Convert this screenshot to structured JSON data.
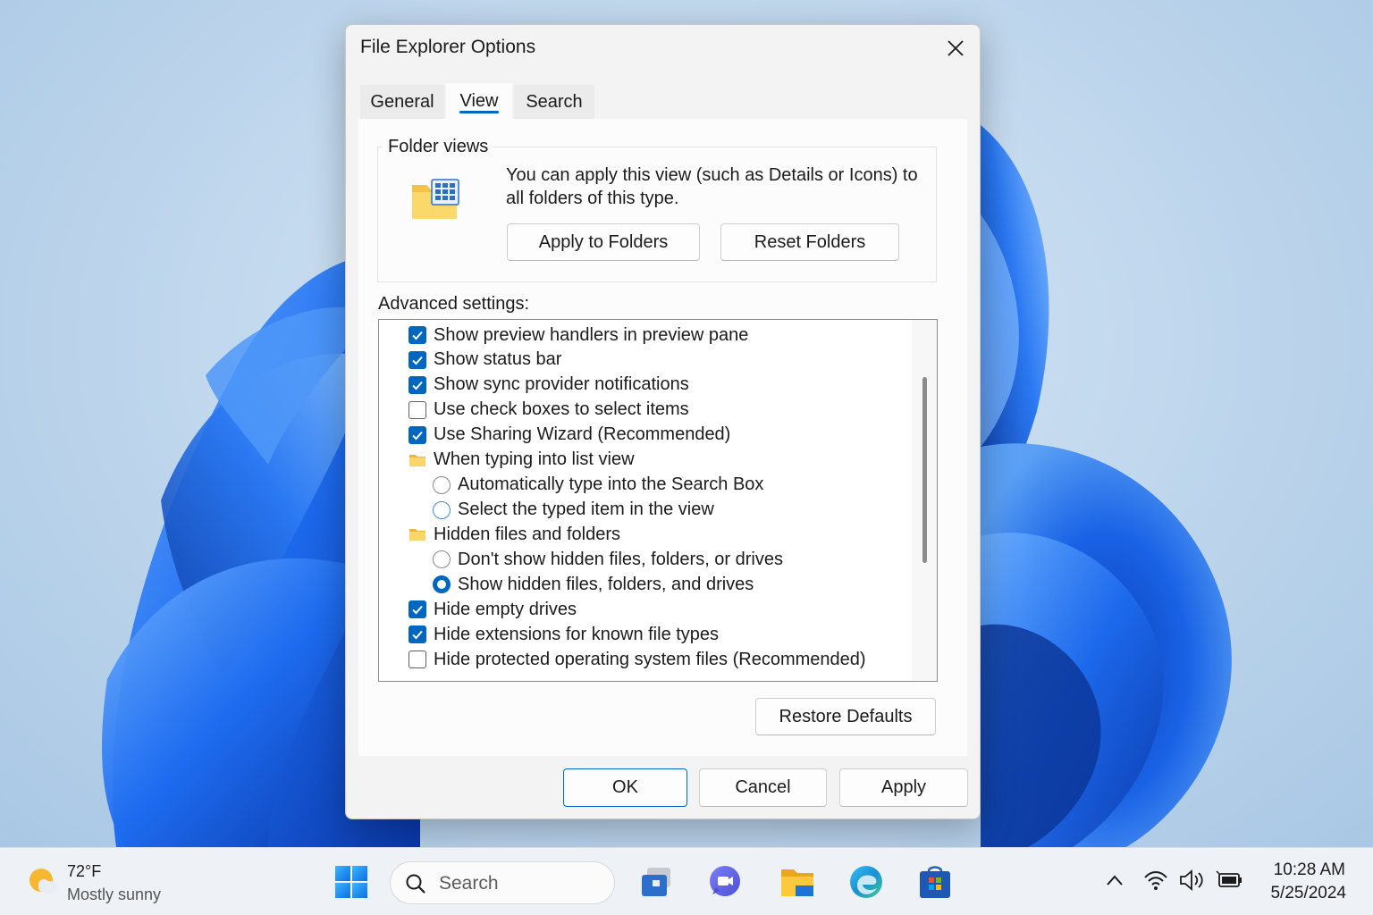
{
  "dialog": {
    "title": "File Explorer Options",
    "tabs": [
      {
        "label": "General",
        "active": false
      },
      {
        "label": "View",
        "active": true
      },
      {
        "label": "Search",
        "active": false
      }
    ],
    "folder_views": {
      "group_label": "Folder views",
      "description": "You can apply this view (such as Details or Icons) to all folders of this type.",
      "apply_button": "Apply to Folders",
      "reset_button": "Reset Folders"
    },
    "advanced": {
      "label": "Advanced settings:",
      "items": [
        {
          "label": "Show preview handlers in preview pane",
          "type": "checkbox",
          "checked": true,
          "level": 0
        },
        {
          "label": "Show status bar",
          "type": "checkbox",
          "checked": true,
          "level": 0
        },
        {
          "label": "Show sync provider notifications",
          "type": "checkbox",
          "checked": true,
          "level": 0
        },
        {
          "label": "Use check boxes to select items",
          "type": "checkbox",
          "checked": false,
          "level": 0
        },
        {
          "label": "Use Sharing Wizard (Recommended)",
          "type": "checkbox",
          "checked": true,
          "level": 0
        },
        {
          "label": "When typing into list view",
          "type": "folder",
          "level": 0
        },
        {
          "label": "Automatically type into the Search Box",
          "type": "radio",
          "checked": false,
          "level": 1
        },
        {
          "label": "Select the typed item in the view",
          "type": "radio",
          "checked": false,
          "focused": true,
          "level": 1
        },
        {
          "label": "Hidden files and folders",
          "type": "folder",
          "level": 0
        },
        {
          "label": "Don't show hidden files, folders, or drives",
          "type": "radio",
          "checked": false,
          "level": 1
        },
        {
          "label": "Show hidden files, folders, and drives",
          "type": "radio",
          "checked": true,
          "level": 1
        },
        {
          "label": "Hide empty drives",
          "type": "checkbox",
          "checked": true,
          "level": 0
        },
        {
          "label": "Hide extensions for known file types",
          "type": "checkbox",
          "checked": true,
          "level": 0
        },
        {
          "label": "Hide protected operating system files (Recommended)",
          "type": "checkbox",
          "checked": false,
          "level": 0
        }
      ],
      "restore_button": "Restore Defaults"
    },
    "buttons": {
      "ok": "OK",
      "cancel": "Cancel",
      "apply": "Apply"
    }
  },
  "taskbar": {
    "weather": {
      "temp": "72°F",
      "desc": "Mostly sunny",
      "icon": "sun-cloud-icon"
    },
    "search_placeholder": "Search",
    "pinned": [
      "start-icon",
      "task-view-icon",
      "chat-icon",
      "file-explorer-icon",
      "edge-icon",
      "store-icon"
    ],
    "tray": [
      "chevron-up-icon",
      "wifi-icon",
      "volume-icon",
      "battery-icon"
    ],
    "clock": {
      "time": "10:28 AM",
      "date": "5/25/2024"
    }
  },
  "colors": {
    "accent": "#0067c0",
    "wallpaper_bloom": "#1a5fe0",
    "taskbar": "#eef2f7"
  }
}
